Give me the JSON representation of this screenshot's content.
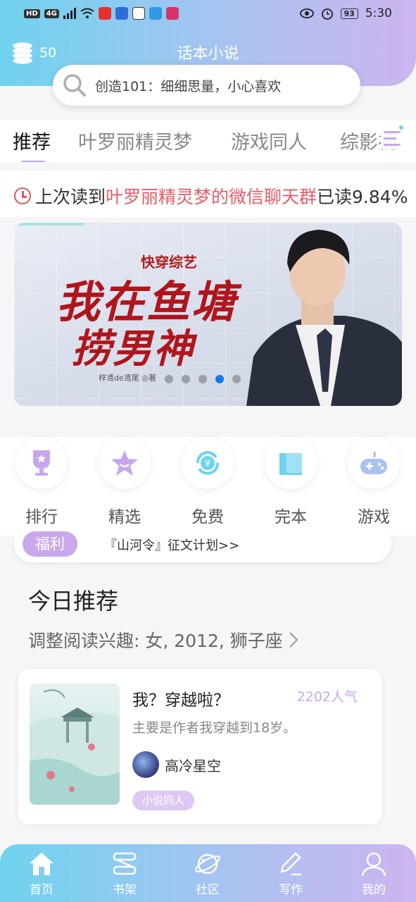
{
  "status_bar": {
    "left_chips": [
      "HD",
      "4G"
    ],
    "time": "5:30",
    "battery": "93"
  },
  "header": {
    "coins": "50",
    "title": "话本小说",
    "search_text": "创造101：细细思量，小心喜欢"
  },
  "tabs": [
    {
      "label": "推荐",
      "active": true
    },
    {
      "label": "叶罗丽精灵梦",
      "active": false
    },
    {
      "label": "游戏同人",
      "active": false
    },
    {
      "label": "综影视",
      "active": false
    }
  ],
  "last_read": {
    "prefix": "上次读到",
    "book": "叶罗丽精灵梦的微信聊天群",
    "progress": "已读9.84%"
  },
  "banner": {
    "subtitle": "快穿综艺",
    "title_line1": "我在鱼塘",
    "title_line2": "捞男神",
    "author": "梓鸢de鸢尾 ◎著",
    "page_count": 5,
    "active_page": 4
  },
  "categories": [
    {
      "label": "排行",
      "icon": "trophy-icon"
    },
    {
      "label": "精选",
      "icon": "star-icon"
    },
    {
      "label": "免费",
      "icon": "yuan-icon"
    },
    {
      "label": "完本",
      "icon": "book-icon"
    },
    {
      "label": "游戏",
      "icon": "gamepad-icon"
    }
  ],
  "welfare": {
    "badge": "福利",
    "text": "『山河令』征文计划>>"
  },
  "today": {
    "title": "今日推荐",
    "interest": "调整阅读兴趣: 女, 2012, 狮子座"
  },
  "card": {
    "title": "我？穿越啦？",
    "popularity": "2202人气",
    "description": "主要是作者我穿越到18岁。",
    "author": "高冷星空",
    "tag": "小说同人"
  },
  "bottom_nav": [
    {
      "label": "首页",
      "icon": "home-icon"
    },
    {
      "label": "书架",
      "icon": "bookshelf-icon"
    },
    {
      "label": "社区",
      "icon": "planet-icon"
    },
    {
      "label": "写作",
      "icon": "pen-icon"
    },
    {
      "label": "我的",
      "icon": "user-icon"
    }
  ],
  "colors": {
    "accent_purple": "#c9a8ec",
    "accent_cyan": "#6fd3ee",
    "highlight_red": "#e85a66",
    "dot_active": "#1577e8"
  }
}
